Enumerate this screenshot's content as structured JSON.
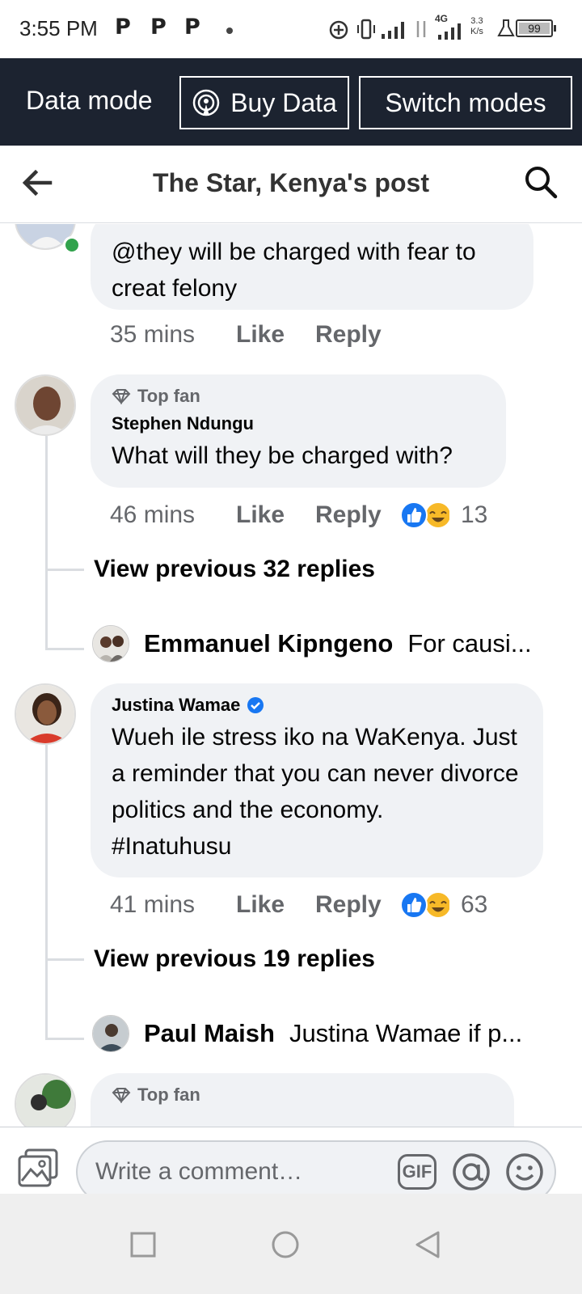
{
  "status_bar": {
    "time": "3:55 PM",
    "badges": [
      "P",
      "P",
      "P"
    ],
    "net_speed_value": "3.3",
    "net_speed_unit": "K/s",
    "signal_label": "4G",
    "battery": "99"
  },
  "data_bar": {
    "mode_label": "Data mode",
    "buy_label": "Buy Data",
    "switch_label": "Switch modes"
  },
  "header": {
    "title": "The Star, Kenya's post"
  },
  "comments": [
    {
      "text": "@they will be charged with fear to creat felony",
      "time": "35 mins",
      "like": "Like",
      "reply": "Reply"
    },
    {
      "badge": "Top fan",
      "author": "Stephen Ndungu",
      "text": "What will they be charged with?",
      "time": "46 mins",
      "like": "Like",
      "reply": "Reply",
      "reactions": "13",
      "view_previous": "View previous 32 replies",
      "latest_reply": {
        "author": "Emmanuel Kipngeno",
        "text": "For  causi..."
      }
    },
    {
      "author": "Justina Wamae",
      "text": "Wueh ile stress iko na WaKenya. Just a reminder that you can never divorce politics and the economy.",
      "hashtag": "#Inatuhusu",
      "time": "41 mins",
      "like": "Like",
      "reply": "Reply",
      "reactions": "63",
      "view_previous": "View previous 19 replies",
      "latest_reply": {
        "author": "Paul Maish",
        "text": "Justina Wamae if p..."
      }
    },
    {
      "badge": "Top fan"
    }
  ],
  "composer": {
    "placeholder": "Write a comment…",
    "gif_label": "GIF"
  },
  "colors": {
    "data_bar_bg": "#1c2330",
    "bubble_bg": "#f0f2f5",
    "secondary_text": "#65676b",
    "verified_blue": "#1877f2",
    "online_green": "#31a24c"
  }
}
